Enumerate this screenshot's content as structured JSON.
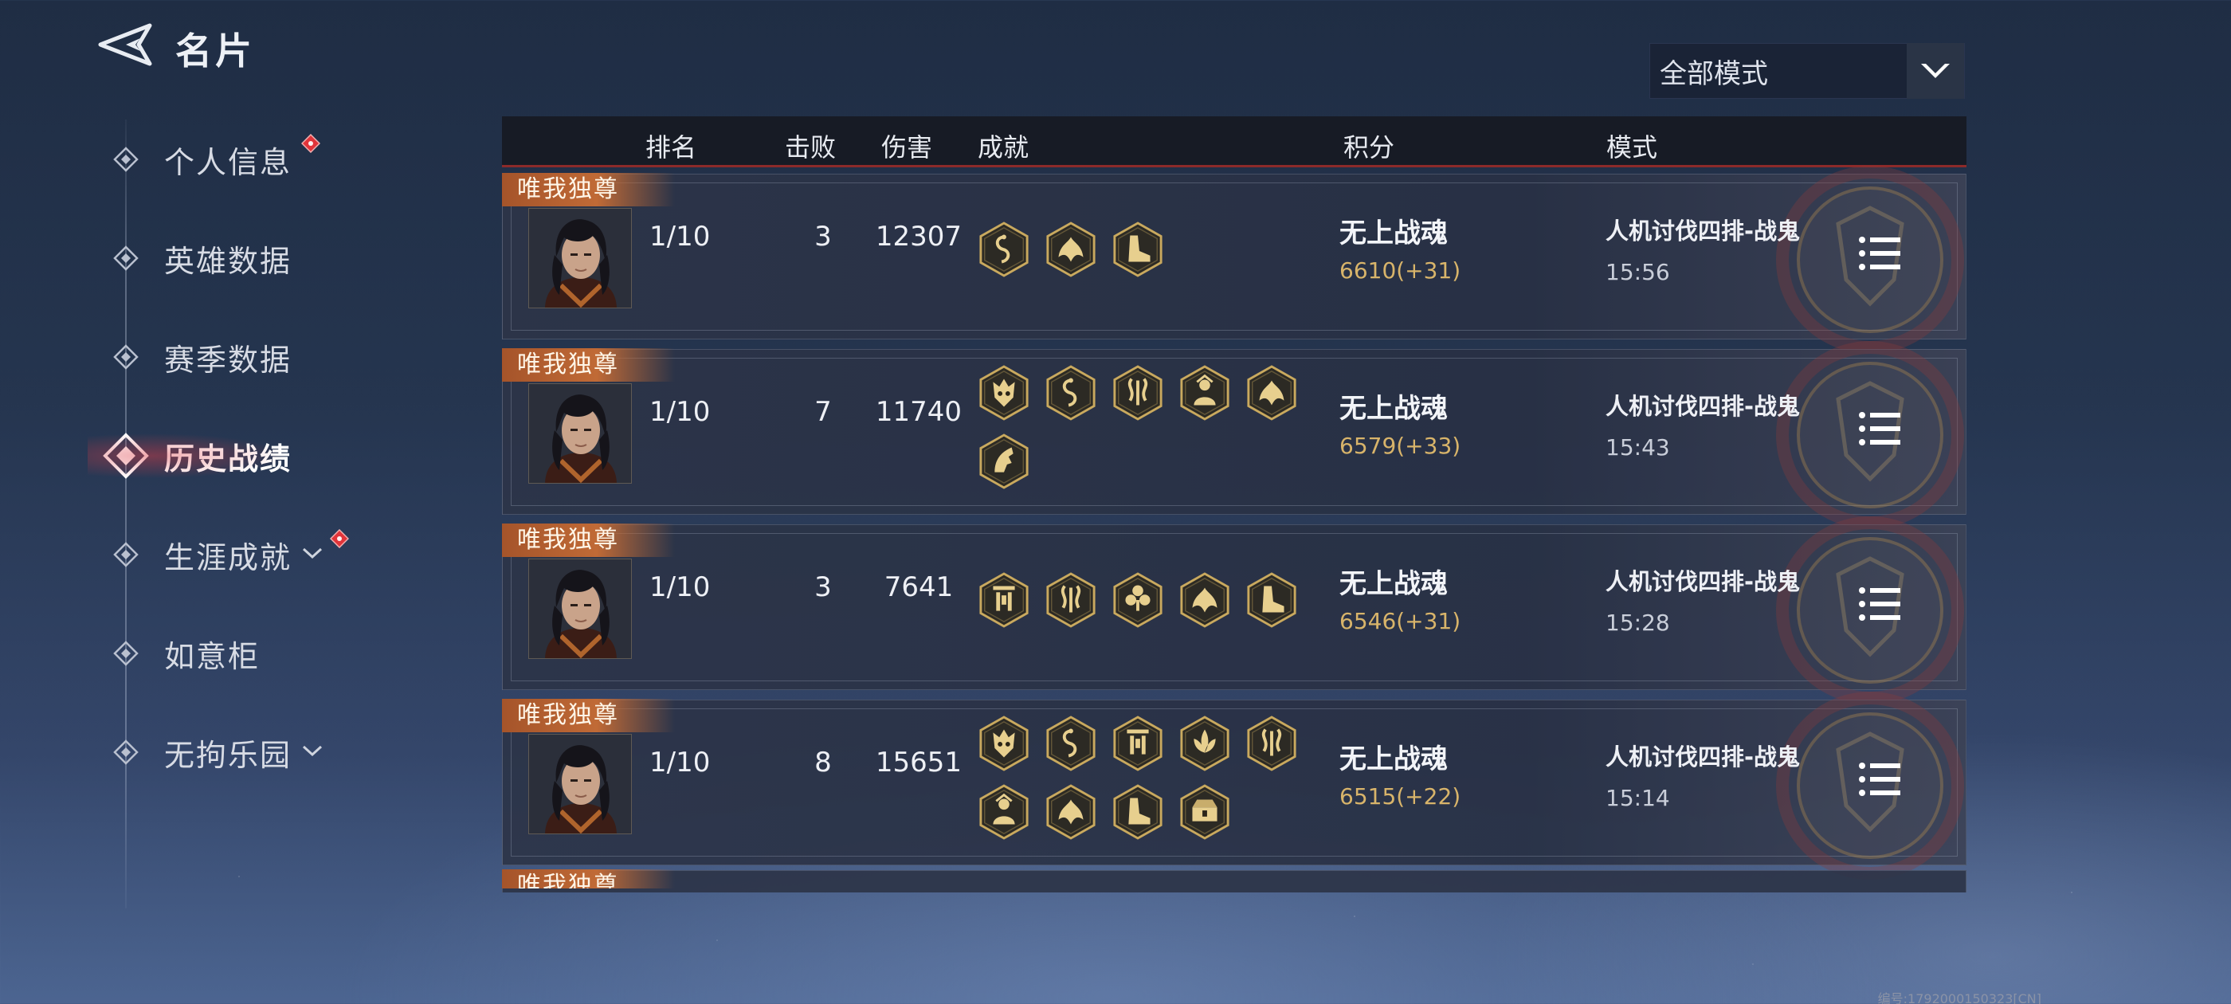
{
  "header": {
    "title": "名片"
  },
  "sidebar": {
    "items": [
      {
        "label": "个人信息",
        "active": false,
        "red_dot": true,
        "has_chevron": false
      },
      {
        "label": "英雄数据",
        "active": false,
        "red_dot": false,
        "has_chevron": false
      },
      {
        "label": "赛季数据",
        "active": false,
        "red_dot": false,
        "has_chevron": false
      },
      {
        "label": "历史战绩",
        "active": true,
        "red_dot": false,
        "has_chevron": false
      },
      {
        "label": "生涯成就",
        "active": false,
        "red_dot": true,
        "has_chevron": true
      },
      {
        "label": "如意柜",
        "active": false,
        "red_dot": false,
        "has_chevron": false
      },
      {
        "label": "无拘乐园",
        "active": false,
        "red_dot": false,
        "has_chevron": true
      }
    ]
  },
  "filter": {
    "selected": "全部模式"
  },
  "table": {
    "columns": {
      "rank": "排名",
      "kills": "击败",
      "damage": "伤害",
      "achievements": "成就",
      "score": "积分",
      "mode": "模式"
    },
    "rows": [
      {
        "badge": "唯我独尊",
        "rank": "1/10",
        "kills": "3",
        "damage": "12307",
        "achievements": [
          "serpent-icon",
          "phoenix-icon",
          "boot-icon"
        ],
        "score_title": "无上战魂",
        "score_value": "6610(+31)",
        "mode": "人机讨伐四排-战鬼",
        "time": "15:56"
      },
      {
        "badge": "唯我独尊",
        "rank": "1/10",
        "kills": "7",
        "damage": "11740",
        "achievements": [
          "demon-mask-icon",
          "serpent-icon",
          "twin-dragon-icon",
          "guardian-icon",
          "phoenix-icon",
          "horse-icon"
        ],
        "score_title": "无上战魂",
        "score_value": "6579(+33)",
        "mode": "人机讨伐四排-战鬼",
        "time": "15:43"
      },
      {
        "badge": "唯我独尊",
        "rank": "1/10",
        "kills": "3",
        "damage": "7641",
        "achievements": [
          "gate-icon",
          "twin-dragon-icon",
          "club-flower-icon",
          "phoenix-icon",
          "boot-icon"
        ],
        "score_title": "无上战魂",
        "score_value": "6546(+31)",
        "mode": "人机讨伐四排-战鬼",
        "time": "15:28"
      },
      {
        "badge": "唯我独尊",
        "rank": "1/10",
        "kills": "8",
        "damage": "15651",
        "achievements": [
          "demon-mask-icon",
          "serpent-icon",
          "gate-icon",
          "lotus-icon",
          "twin-dragon-icon",
          "guardian-icon",
          "phoenix-icon",
          "boot-icon",
          "chest-icon"
        ],
        "score_title": "无上战魂",
        "score_value": "6515(+22)",
        "mode": "人机讨伐四排-战鬼",
        "time": "15:14"
      }
    ],
    "partial_row_badge": "唯我独尊"
  },
  "footer": {
    "id_text": "编号:1792000150323[CN]"
  },
  "colors": {
    "accent_gold": "#d8b46a",
    "badge_orange": "#c06a36",
    "header_underline": "#8c2a2a",
    "active_glow": "#dc3c46"
  }
}
